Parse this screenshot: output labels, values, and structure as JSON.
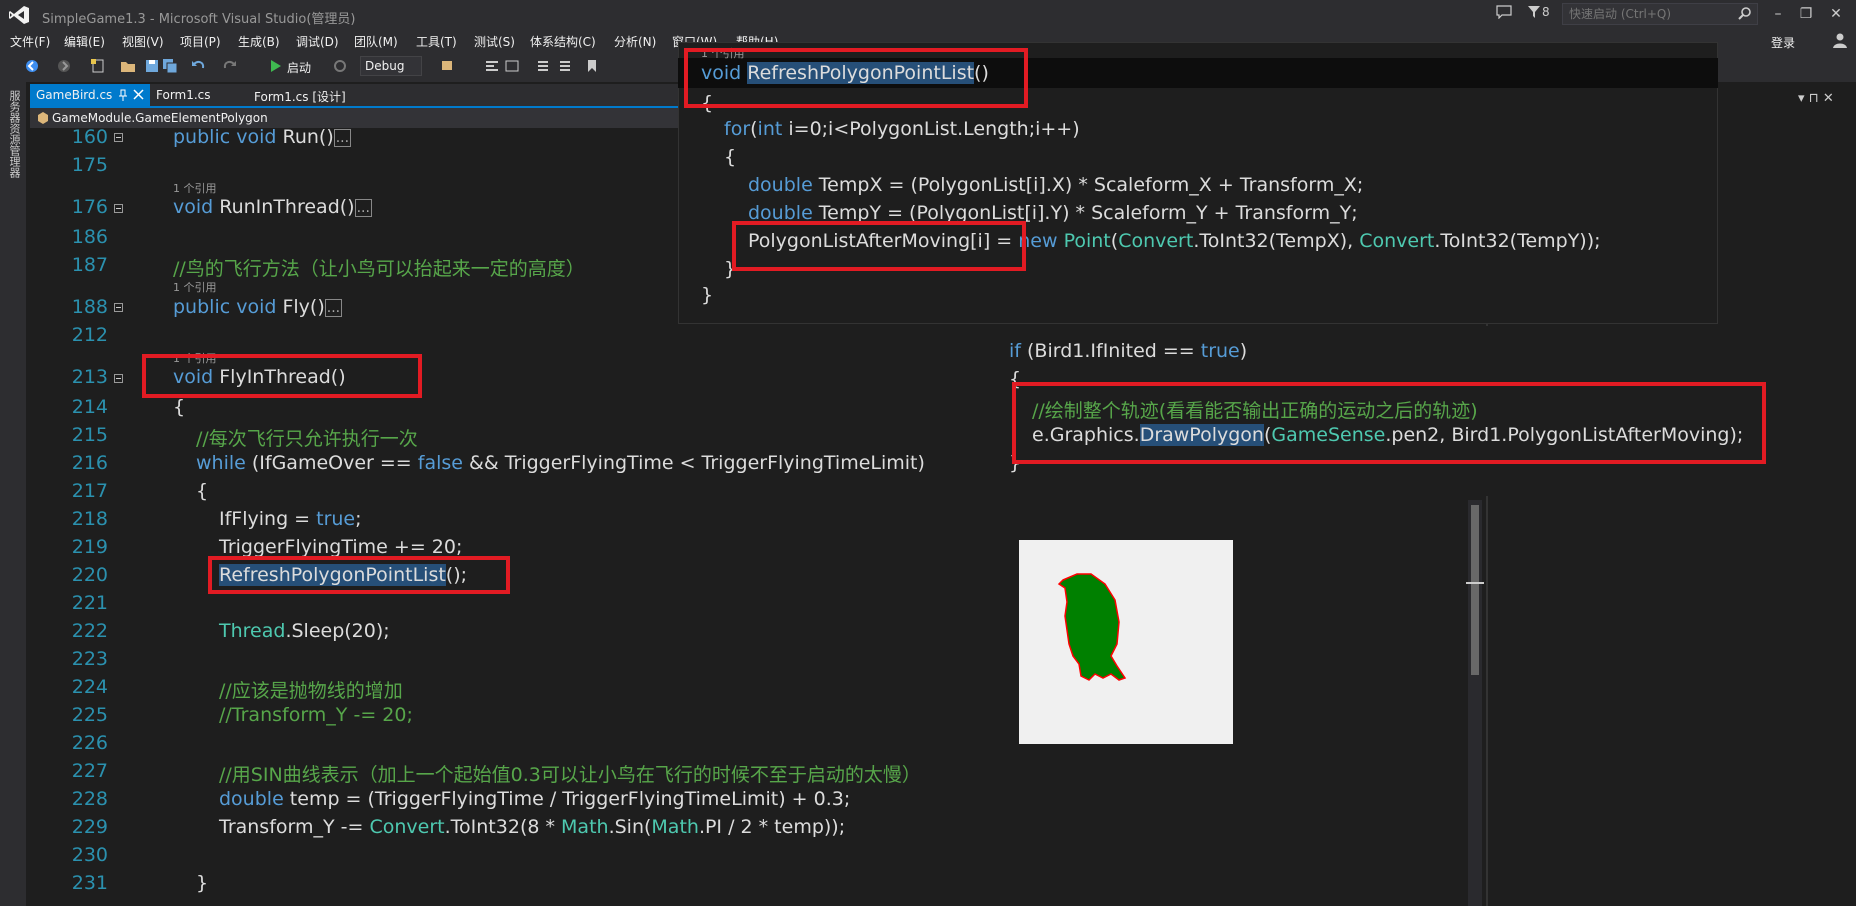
{
  "window": {
    "title": "SimpleGame1.3 - Microsoft Visual Studio(管理员)",
    "notif_count": "8",
    "quicklaunch_placeholder": "快速启动 (Ctrl+Q)",
    "login": "登录",
    "min": "–",
    "max": "❐",
    "close": "✕"
  },
  "menu": [
    "文件(F)",
    "编辑(E)",
    "视图(V)",
    "项目(P)",
    "生成(B)",
    "调试(D)",
    "团队(M)",
    "工具(T)",
    "测试(S)",
    "体系结构(C)",
    "分析(N)",
    "窗口(W)",
    "帮助(H)"
  ],
  "toolbar": {
    "start": "启动",
    "config": "Debug"
  },
  "side_strip": "服务器资源管理器",
  "tabs": [
    {
      "label": "GameBird.cs",
      "active": true
    },
    {
      "label": "Form1.cs",
      "active": false
    },
    {
      "label": "Form1.cs [设计]",
      "active": false
    }
  ],
  "nav": {
    "path": "GameModule.GameElementPolygon"
  },
  "ref_label": "1 个引用",
  "lines": {
    "l160": {
      "num": "160",
      "kw": "public void ",
      "name": "Run()"
    },
    "l175": {
      "num": "175"
    },
    "l176": {
      "num": "176",
      "kw": "void ",
      "name": "RunInThread()"
    },
    "l186": {
      "num": "186"
    },
    "l187": {
      "num": "187",
      "comment": "//鸟的飞行方法（让小鸟可以抬起来一定的高度）"
    },
    "l188": {
      "num": "188",
      "kw": "public void ",
      "name": "Fly()"
    },
    "l212": {
      "num": "212"
    },
    "l213": {
      "num": "213",
      "kw": "void ",
      "name": "FlyInThread()"
    },
    "l214": {
      "num": "214",
      "text": "{"
    },
    "l215": {
      "num": "215",
      "comment": "//每次飞行只允许执行一次"
    },
    "l216": {
      "num": "216",
      "kw": "while",
      "a": " (IfGameOver == ",
      "false": "false",
      "b": " && TriggerFlyingTime < TriggerFlyingTimeLimit)"
    },
    "l217": {
      "num": "217",
      "text": "{"
    },
    "l218": {
      "num": "218",
      "a": "IfFlying = ",
      "true": "true",
      "b": ";"
    },
    "l219": {
      "num": "219",
      "text": "TriggerFlyingTime += 20;"
    },
    "l220": {
      "num": "220",
      "call": "RefreshPolygonPointList",
      "tail": "();"
    },
    "l221": {
      "num": "221"
    },
    "l222": {
      "num": "222",
      "type": "Thread",
      "tail": ".Sleep(20);"
    },
    "l223": {
      "num": "223"
    },
    "l224": {
      "num": "224",
      "comment": "//应该是抛物线的增加"
    },
    "l225": {
      "num": "225",
      "comment": "//Transform_Y -= 20;"
    },
    "l226": {
      "num": "226"
    },
    "l227": {
      "num": "227",
      "comment": "//用SIN曲线表示（加上一个起始值0.3可以让小鸟在飞行的时候不至于启动的太慢）"
    },
    "l228": {
      "num": "228",
      "kw": "double",
      "tail": " temp =  (TriggerFlyingTime / TriggerFlyingTimeLimit) + 0.3;"
    },
    "l229": {
      "num": "229",
      "a": "Transform_Y -= ",
      "t1": "Convert",
      "b": ".ToInt32(8 * ",
      "t2": "Math",
      "c": ".Sin(",
      "t3": "Math",
      "d": ".PI / 2 * temp));"
    },
    "l230": {
      "num": "230"
    },
    "l231": {
      "num": "231",
      "text": "}"
    }
  },
  "popup1": {
    "ref": "1 个引用",
    "sig_kw": "void ",
    "sig_name": "RefreshPolygonPointList",
    "sig_tail": "()",
    "open": "{",
    "for_kw": "for",
    "for_a": "(",
    "for_int": "int",
    "for_b": " i=0;i<PolygonList.Length;i++)",
    "inner_open": "{",
    "tx_kw": "double",
    "tx": " TempX = (PolygonList[i].X) * Scaleform_X + Transform_X;",
    "ty_kw": "double",
    "ty": " TempY = (PolygonList[i].Y) * Scaleform_Y + Transform_Y;",
    "assign": "PolygonListAfterMoving[i]",
    "eq": " = ",
    "new_kw": "new",
    "point": "Point",
    "p1": "(",
    "conv1": "Convert",
    "p2": ".ToInt32(TempX), ",
    "conv2": "Convert",
    "p3": ".ToInt32(TempY));",
    "inner_close": "}",
    "close": "}"
  },
  "popup2": {
    "if_kw": "if",
    "if_a": " (Bird1.IfInited == ",
    "if_true": "true",
    "if_b": ")",
    "open": "{",
    "comment": "//绘制整个轨迹(看看能否输出正确的运动之后的轨迹)",
    "call_a": "e.Graphics.",
    "call_hl": "DrawPolygon",
    "call_b": "(",
    "call_type": "GameSense",
    "call_c": ".pen2, Bird1.PolygonListAfterMoving);",
    "close": "}"
  },
  "colors": {
    "keyword": "#569cd6",
    "type": "#4ec9b0",
    "comment": "#57a64a",
    "highlight": "#e21b23",
    "bird_fill": "#008000",
    "bird_outline": "#ff0000"
  }
}
